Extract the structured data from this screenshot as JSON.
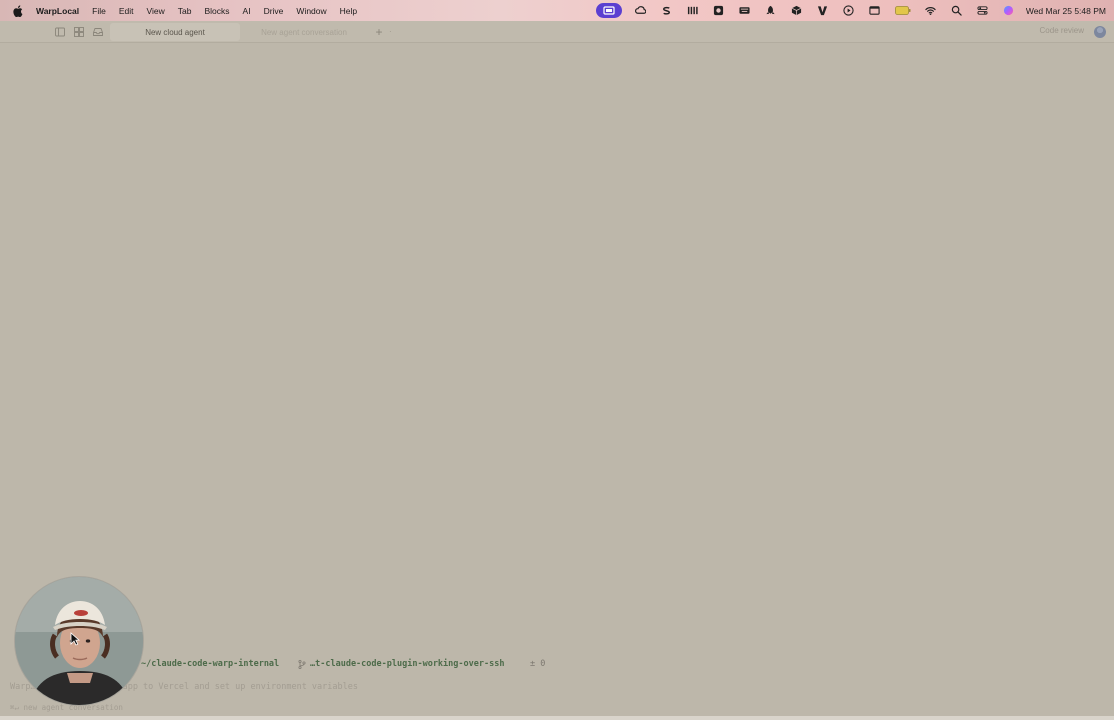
{
  "menubar": {
    "app_name": "WarpLocal",
    "menus": [
      "File",
      "Edit",
      "View",
      "Tab",
      "Blocks",
      "AI",
      "Drive",
      "Window",
      "Help"
    ],
    "clock": "Wed Mar 25  5:48 PM",
    "status_icons": [
      "screen-recording-icon",
      "creative-cloud-icon",
      "stripe-icon",
      "ableton-icon",
      "camera-icon",
      "keyboard-icon",
      "rocket-icon",
      "package-icon",
      "vectorworks-icon",
      "play-circle-icon",
      "window-icon",
      "battery-icon",
      "wifi-icon",
      "search-icon",
      "control-center-icon",
      "siri-icon"
    ],
    "accent": "#5b3fd1"
  },
  "tabbar": {
    "tabs": [
      {
        "label": "New cloud agent",
        "active": true
      },
      {
        "label": "New agent conversation",
        "active": false
      }
    ],
    "code_review_label": "Code review"
  },
  "prompt": {
    "path": "~/claude-code-warp-internal",
    "branch": "…t-claude-code-plugin-working-over-ssh",
    "diff_count": "± 0",
    "path_color": "#4d6b4a"
  },
  "input": {
    "placeholder": "Warp… deploy my React app to Vercel and set up environment variables"
  },
  "footer": {
    "hint": "⌘↵ new agent conversation"
  }
}
